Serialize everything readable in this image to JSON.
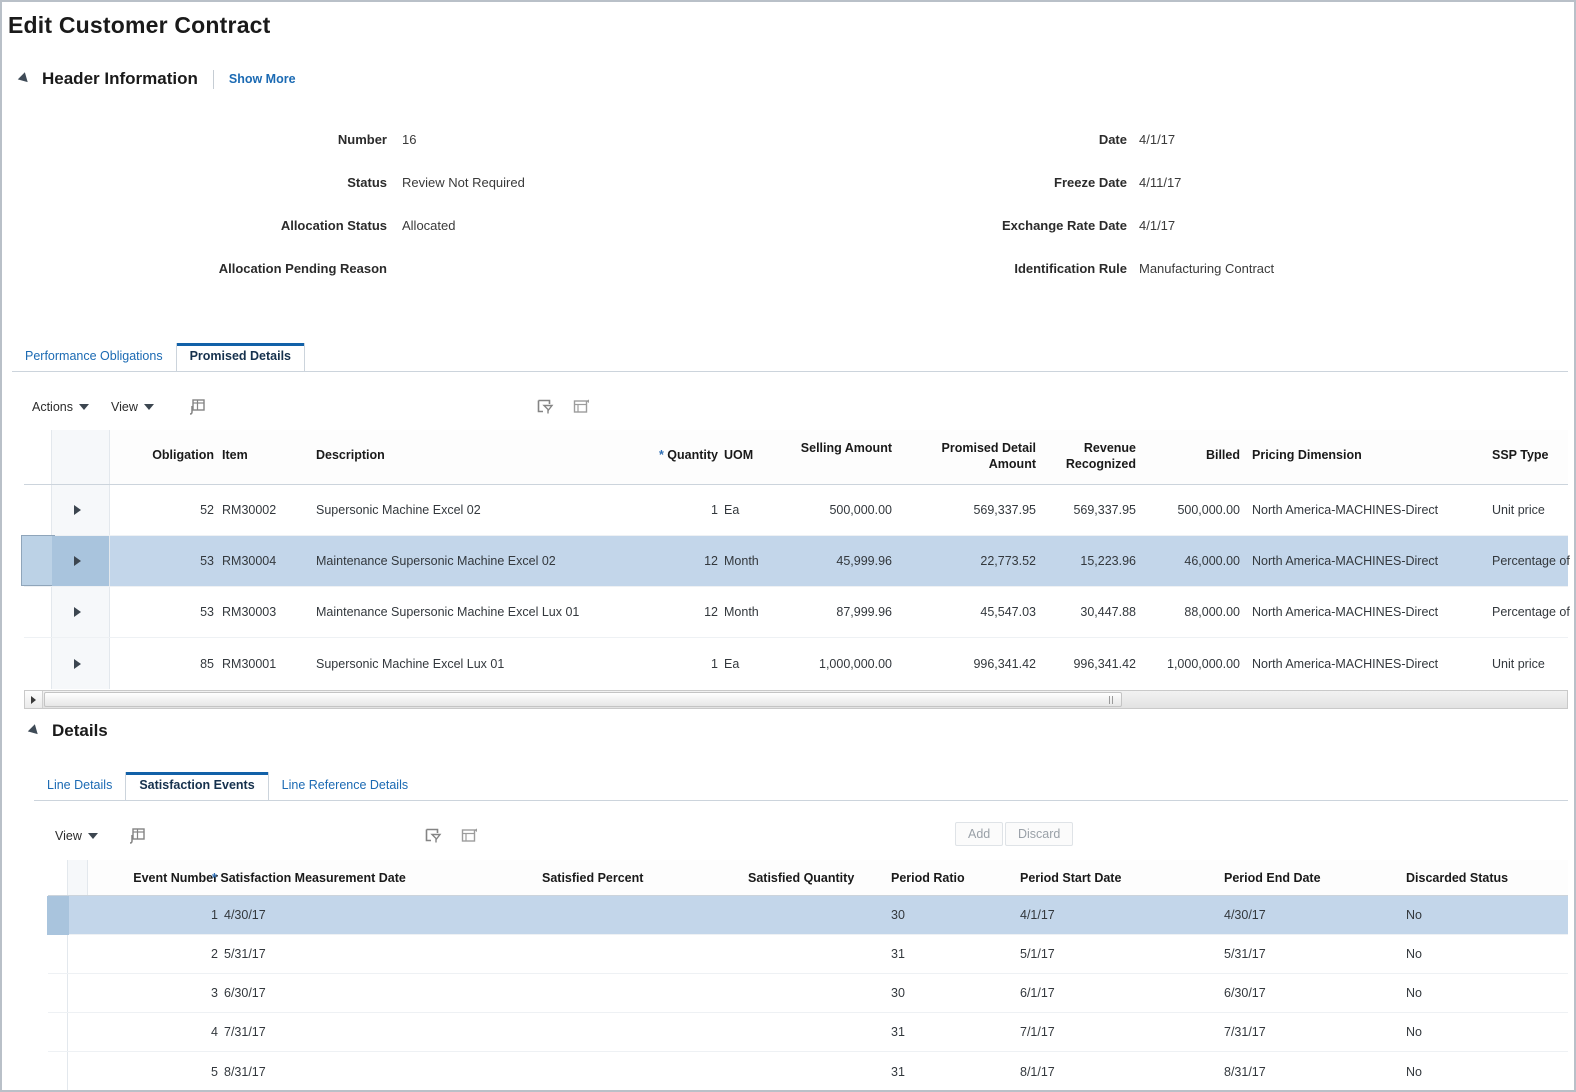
{
  "page": {
    "title": "Edit Customer Contract"
  },
  "header_section": {
    "title": "Header Information",
    "show_more_label": "Show More",
    "left_fields": [
      {
        "label": "Number",
        "value": "16"
      },
      {
        "label": "Status",
        "value": "Review Not Required"
      },
      {
        "label": "Allocation Status",
        "value": "Allocated"
      },
      {
        "label": "Allocation Pending Reason",
        "value": ""
      }
    ],
    "right_fields": [
      {
        "label": "Date",
        "value": "4/1/17"
      },
      {
        "label": "Freeze Date",
        "value": "4/11/17"
      },
      {
        "label": "Exchange Rate Date",
        "value": "4/1/17"
      },
      {
        "label": "Identification Rule",
        "value": "Manufacturing Contract"
      }
    ]
  },
  "main_tabs": [
    {
      "label": "Performance Obligations",
      "active": false
    },
    {
      "label": "Promised Details",
      "active": true
    }
  ],
  "main_toolbar": {
    "actions_label": "Actions",
    "view_label": "View",
    "icons": [
      "freeze-columns-icon",
      "detach-icon",
      "wrap-icon"
    ]
  },
  "promised_details_grid": {
    "columns": [
      {
        "key": "obligation",
        "label": "Obligation",
        "required": false
      },
      {
        "key": "item",
        "label": "Item",
        "required": false
      },
      {
        "key": "description",
        "label": "Description",
        "required": false
      },
      {
        "key": "quantity",
        "label": "Quantity",
        "required": true
      },
      {
        "key": "uom",
        "label": "UOM",
        "required": false
      },
      {
        "key": "selling_amount",
        "label": "Selling Amount",
        "required": false
      },
      {
        "key": "promised_detail_amount",
        "label": "Promised Detail Amount",
        "required": false
      },
      {
        "key": "revenue_recognized",
        "label": "Revenue Recognized",
        "required": false
      },
      {
        "key": "billed",
        "label": "Billed",
        "required": false
      },
      {
        "key": "pricing_dimension",
        "label": "Pricing Dimension",
        "required": false
      },
      {
        "key": "ssp_type",
        "label": "SSP Type",
        "required": false
      }
    ],
    "rows": [
      {
        "obligation": "52",
        "item": "RM30002",
        "description": "Supersonic Machine Excel 02",
        "quantity": "1",
        "uom": "Ea",
        "selling_amount": "500,000.00",
        "promised_detail_amount": "569,337.95",
        "revenue_recognized": "569,337.95",
        "billed": "500,000.00",
        "pricing_dimension": "North America-MACHINES-Direct",
        "ssp_type": "Unit price",
        "selected": false
      },
      {
        "obligation": "53",
        "item": "RM30004",
        "description": "Maintenance Supersonic Machine Excel 02",
        "quantity": "12",
        "uom": "Month",
        "selling_amount": "45,999.96",
        "promised_detail_amount": "22,773.52",
        "revenue_recognized": "15,223.96",
        "billed": "46,000.00",
        "pricing_dimension": "North America-MACHINES-Direct",
        "ssp_type": "Percentage of",
        "selected": true
      },
      {
        "obligation": "53",
        "item": "RM30003",
        "description": "Maintenance Supersonic Machine Excel Lux 01",
        "quantity": "12",
        "uom": "Month",
        "selling_amount": "87,999.96",
        "promised_detail_amount": "45,547.03",
        "revenue_recognized": "30,447.88",
        "billed": "88,000.00",
        "pricing_dimension": "North America-MACHINES-Direct",
        "ssp_type": "Percentage of",
        "selected": false
      },
      {
        "obligation": "85",
        "item": "RM30001",
        "description": "Supersonic Machine Excel Lux 01",
        "quantity": "1",
        "uom": "Ea",
        "selling_amount": "1,000,000.00",
        "promised_detail_amount": "996,341.42",
        "revenue_recognized": "996,341.42",
        "billed": "1,000,000.00",
        "pricing_dimension": "North America-MACHINES-Direct",
        "ssp_type": "Unit price",
        "selected": false
      }
    ]
  },
  "details_section": {
    "title": "Details"
  },
  "details_tabs": [
    {
      "label": "Line Details",
      "active": false
    },
    {
      "label": "Satisfaction Events",
      "active": true
    },
    {
      "label": "Line Reference Details",
      "active": false
    }
  ],
  "details_toolbar": {
    "view_label": "View",
    "add_label": "Add",
    "discard_label": "Discard",
    "icons": [
      "freeze-columns-icon",
      "detach-icon",
      "wrap-icon"
    ]
  },
  "satisfaction_events_grid": {
    "columns": [
      {
        "key": "event_number",
        "label": "Event Number",
        "required": false
      },
      {
        "key": "measurement_date",
        "label": "Satisfaction Measurement Date",
        "required": true
      },
      {
        "key": "satisfied_percent",
        "label": "Satisfied Percent",
        "required": false
      },
      {
        "key": "satisfied_quantity",
        "label": "Satisfied Quantity",
        "required": false
      },
      {
        "key": "period_ratio",
        "label": "Period Ratio",
        "required": false
      },
      {
        "key": "period_start_date",
        "label": "Period Start Date",
        "required": false
      },
      {
        "key": "period_end_date",
        "label": "Period End Date",
        "required": false
      },
      {
        "key": "discarded_status",
        "label": "Discarded Status",
        "required": false
      }
    ],
    "rows": [
      {
        "event_number": "1",
        "measurement_date": "4/30/17",
        "satisfied_percent": "",
        "satisfied_quantity": "",
        "period_ratio": "30",
        "period_start_date": "4/1/17",
        "period_end_date": "4/30/17",
        "discarded_status": "No",
        "selected": true
      },
      {
        "event_number": "2",
        "measurement_date": "5/31/17",
        "satisfied_percent": "",
        "satisfied_quantity": "",
        "period_ratio": "31",
        "period_start_date": "5/1/17",
        "period_end_date": "5/31/17",
        "discarded_status": "No",
        "selected": false
      },
      {
        "event_number": "3",
        "measurement_date": "6/30/17",
        "satisfied_percent": "",
        "satisfied_quantity": "",
        "period_ratio": "30",
        "period_start_date": "6/1/17",
        "period_end_date": "6/30/17",
        "discarded_status": "No",
        "selected": false
      },
      {
        "event_number": "4",
        "measurement_date": "7/31/17",
        "satisfied_percent": "",
        "satisfied_quantity": "",
        "period_ratio": "31",
        "period_start_date": "7/1/17",
        "period_end_date": "7/31/17",
        "discarded_status": "No",
        "selected": false
      },
      {
        "event_number": "5",
        "measurement_date": "8/31/17",
        "satisfied_percent": "",
        "satisfied_quantity": "",
        "period_ratio": "31",
        "period_start_date": "8/1/17",
        "period_end_date": "8/31/17",
        "discarded_status": "No",
        "selected": false
      }
    ]
  },
  "colors": {
    "link": "#1b6ab3",
    "tab_active_underline": "#1261a8",
    "row_selected": "#c3d6ea",
    "required_star": "#2f6fb5"
  }
}
